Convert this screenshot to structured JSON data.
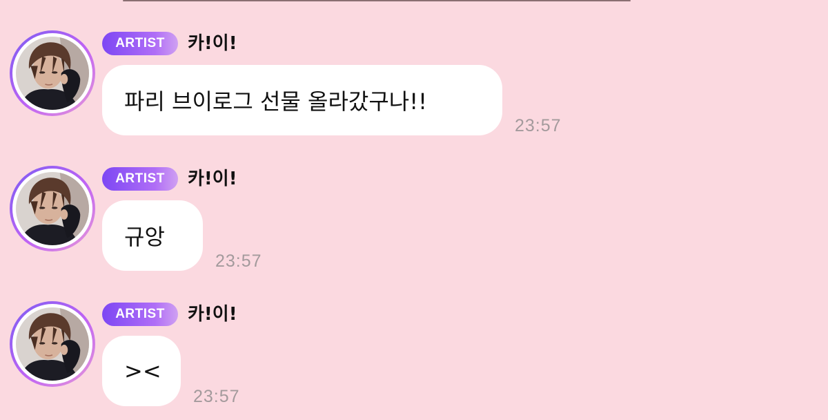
{
  "messages": [
    {
      "badge": "ARTIST",
      "sender": "카!이!",
      "text": "파리 브이로그 선물 올라갔구나!!",
      "time": "23:57"
    },
    {
      "badge": "ARTIST",
      "sender": "카!이!",
      "text": "규앙",
      "time": "23:57"
    },
    {
      "badge": "ARTIST",
      "sender": "카!이!",
      "text": "><",
      "time": "23:57"
    }
  ],
  "colors": {
    "background": "#fbd9e0",
    "bubble": "#ffffff",
    "badge_start": "#7d47f4",
    "badge_end": "#cfa0f2",
    "timestamp": "#a39a9c"
  },
  "icons": {
    "avatar": "artist-profile-photo"
  }
}
